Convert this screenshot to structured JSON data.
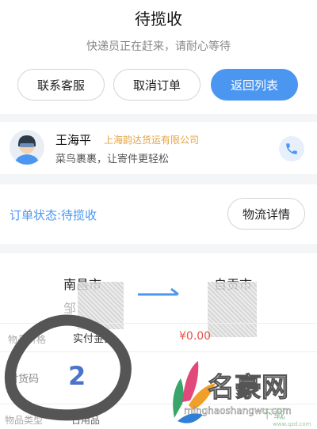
{
  "header": {
    "title": "待揽收",
    "subtitle": "快递员正在赶来，请耐心等待"
  },
  "actions": {
    "contact_label": "联系客服",
    "cancel_label": "取消订单",
    "back_label": "返回列表"
  },
  "courier": {
    "name": "王海平",
    "company": "上海韵达货运有限公司",
    "slogan": "菜鸟裹裹，让寄件更轻松",
    "avatar_icon": "courier-avatar-icon",
    "phone_icon": "phone-icon"
  },
  "order": {
    "status_text": "订单状态:待揽收",
    "logistics_label": "物流详情"
  },
  "route": {
    "from_city": "南昌市",
    "from_detail": "邹",
    "to_city": "自贡市"
  },
  "details": {
    "row1_label": "物品价格",
    "row1_value": "实付金额",
    "price": "¥0.00",
    "row2_label": "对货码",
    "row3_label": "物品类型",
    "row3_value": "日用品"
  },
  "annotation": {
    "number": "2"
  },
  "watermark": {
    "brand": "名豪网",
    "site": "minghaoshangwu.com",
    "corner": "下载",
    "corner_url": "www.qzd.com"
  },
  "colors": {
    "accent": "#4a96f1",
    "company": "#e6a341",
    "price": "#e8524a"
  }
}
